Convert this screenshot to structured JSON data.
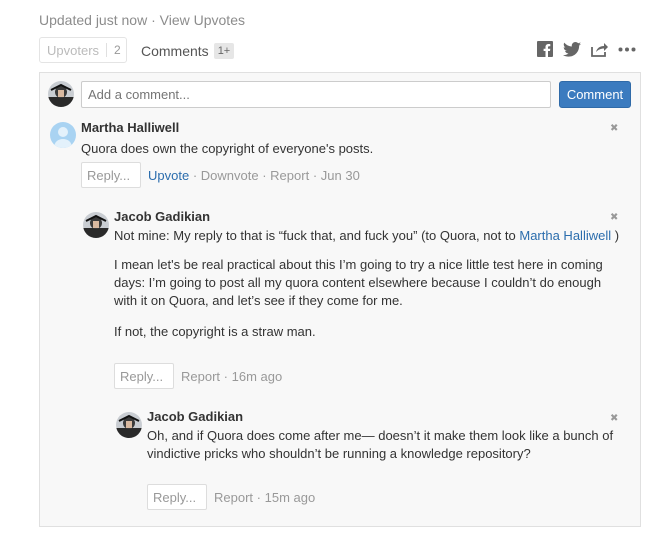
{
  "header": {
    "updated": "Updated just now",
    "dot": "·",
    "view_upvotes": "View Upvotes"
  },
  "tabs": {
    "upvoters_label": "Upvoters",
    "upvoters_count": "2",
    "comments_label": "Comments",
    "comments_count": "1+"
  },
  "share_icons": [
    "facebook-icon",
    "twitter-icon",
    "share-icon",
    "more-icon"
  ],
  "composer": {
    "placeholder": "Add a comment...",
    "submit_label": "Comment"
  },
  "comments": [
    {
      "author": "Martha Halliwell",
      "text": "Quora does own the copyright of everyone's posts.",
      "reply_label": "Reply...",
      "upvote": "Upvote",
      "downvote": "Downvote",
      "report": "Report",
      "time": "Jun 30"
    },
    {
      "author": "Jacob Gadikian",
      "text_prefix": "Not mine: My reply to that is “fuck that, and fuck you” (to Quora, not to",
      "mention": "Martha Halliwell",
      "text_suffix": ")",
      "para2": "I mean let's be real practical about this I’m going to try a nice little test here in coming days: I’m going to post all my quora content elsewhere because I couldn’t do enough with it on Quora, and let’s see if they come for me.",
      "para3": "If not, the copyright is a straw man.",
      "reply_label": "Reply...",
      "report": "Report",
      "time": "16m ago"
    },
    {
      "author": "Jacob Gadikian",
      "text": "Oh, and if Quora does come after me— doesn’t it make them look like a bunch of vindictive pricks who shouldn’t be running a knowledge repository?",
      "reply_label": "Reply...",
      "report": "Report",
      "time": "15m ago"
    }
  ],
  "colors": {
    "accent": "#3b7bbf",
    "link": "#2b6dad",
    "panel_bg": "#f8f8f8"
  }
}
